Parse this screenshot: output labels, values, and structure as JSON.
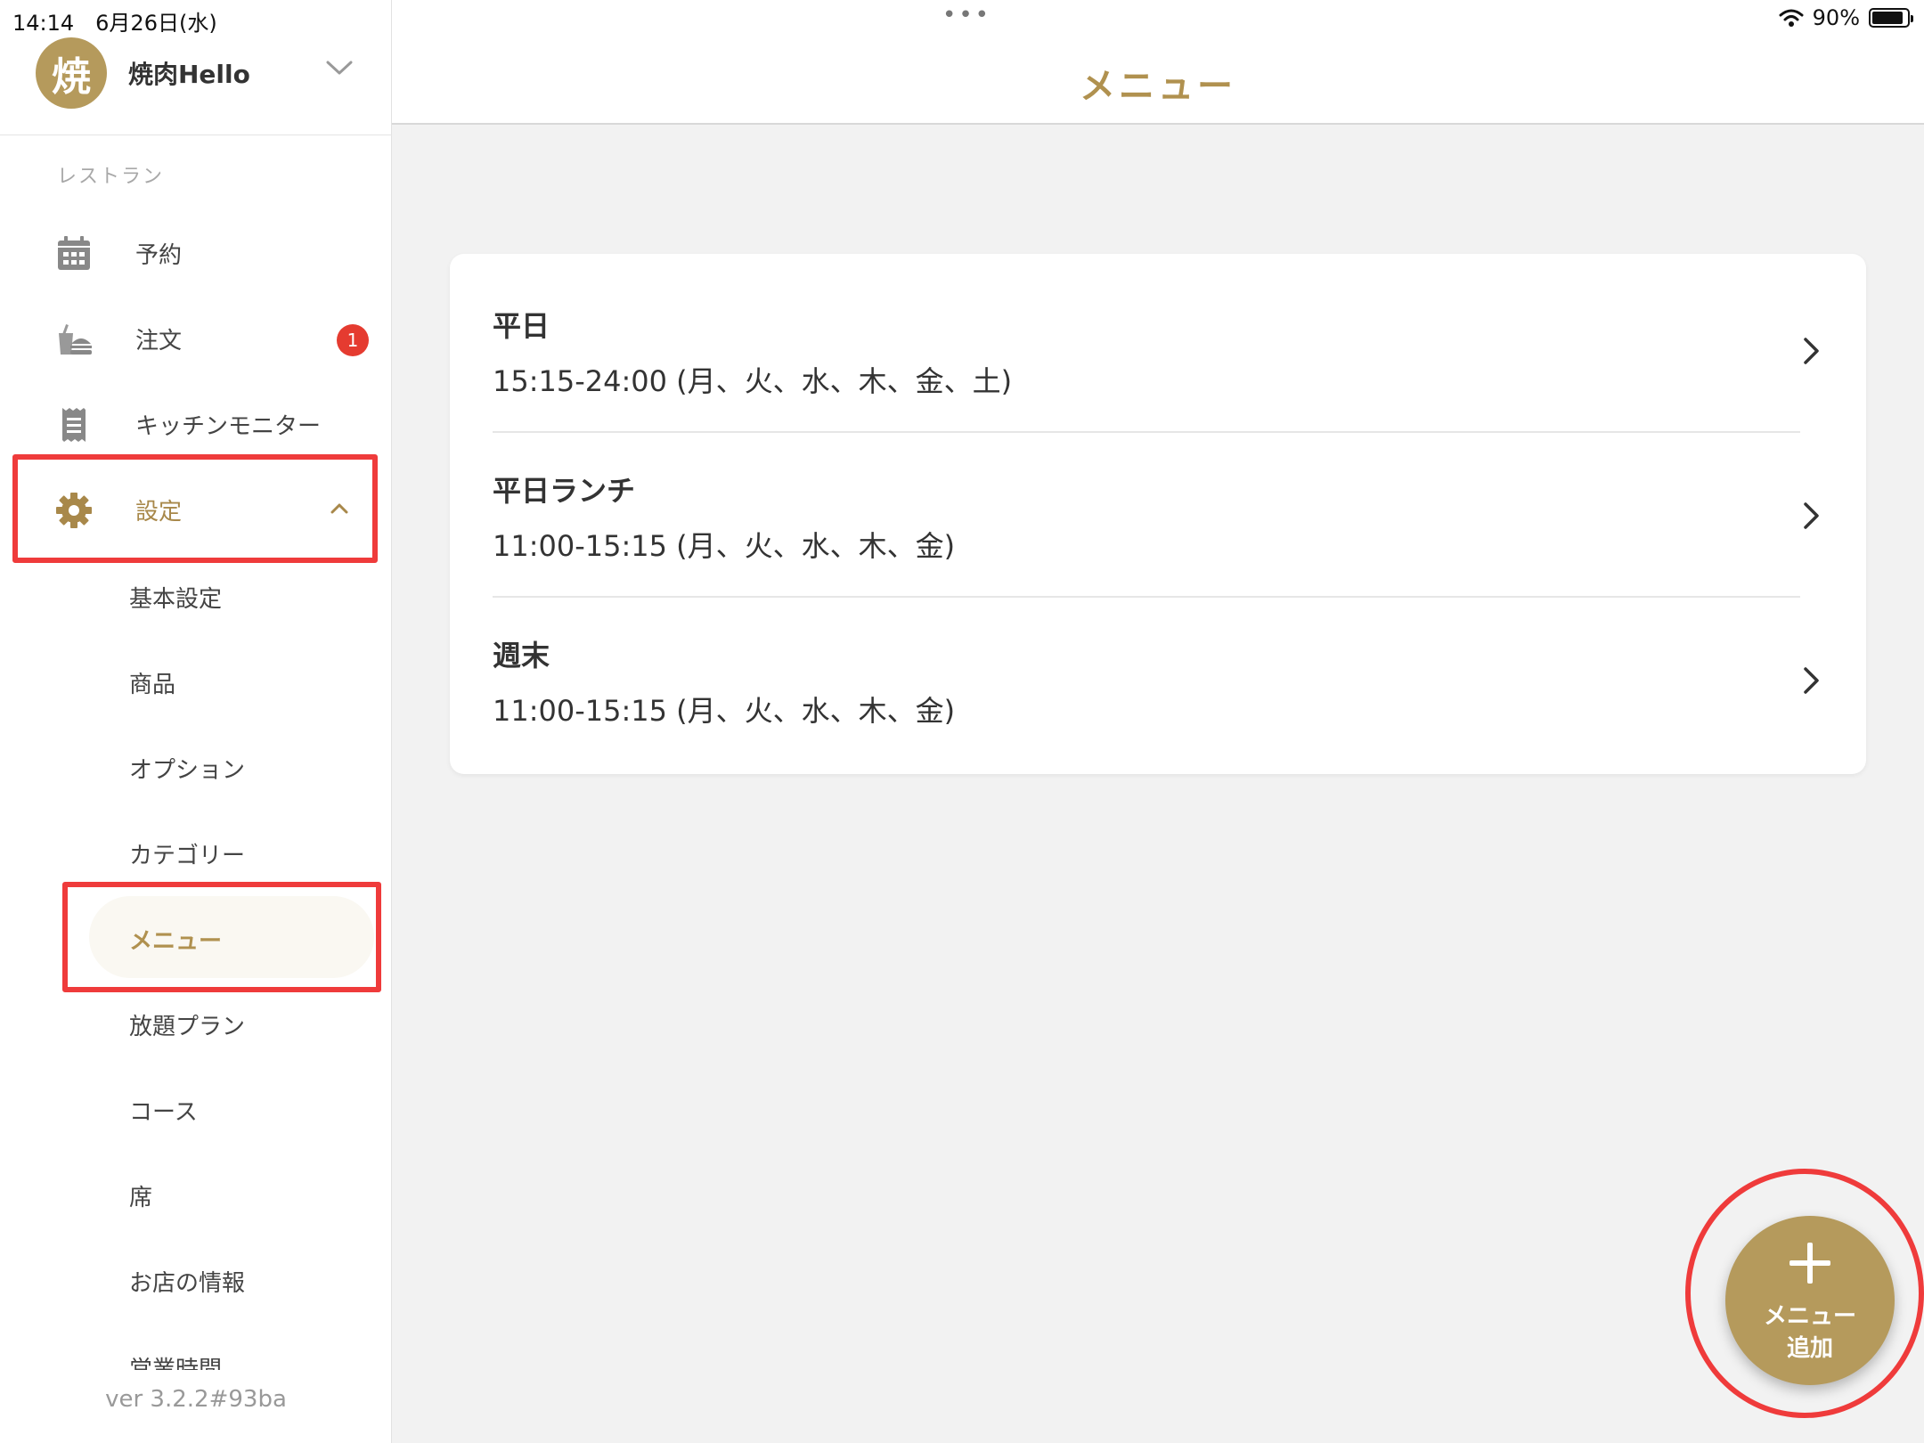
{
  "status_bar": {
    "time_date": "14:14　6月26日(水)",
    "battery_label": "90%",
    "battery_level": 0.9
  },
  "sidebar": {
    "account": {
      "avatar": "焼",
      "name": "焼肉Hello"
    },
    "section_label": "レストラン",
    "nav": [
      {
        "label": "予約",
        "icon": "calendar-icon"
      },
      {
        "label": "注文",
        "icon": "order-icon",
        "badge": "1"
      },
      {
        "label": "キッチンモニター",
        "icon": "receipt-icon"
      },
      {
        "label": "設定",
        "icon": "gear-icon"
      }
    ],
    "settings_sub": [
      "基本設定",
      "商品",
      "オプション",
      "カテゴリー",
      "メニュー",
      "放題プラン",
      "コース",
      "席",
      "お店の情報"
    ],
    "clipped_item": "営業時間",
    "version": "ver 3.2.2#93ba"
  },
  "header": {
    "title": "メニュー"
  },
  "menus": [
    {
      "name": "平日",
      "schedule": "15:15-24:00 (月、火、水、木、金、土)"
    },
    {
      "name": "平日ランチ",
      "schedule": "11:00-15:15 (月、火、水、木、金)"
    },
    {
      "name": "週末",
      "schedule": "11:00-15:15 (月、火、水、木、金)"
    }
  ],
  "fab": {
    "line1": "メニュー",
    "line2": "追加"
  },
  "colors": {
    "accent": "#b59a5c",
    "highlight": "#ef3b3b",
    "badge": "#e53b30"
  }
}
